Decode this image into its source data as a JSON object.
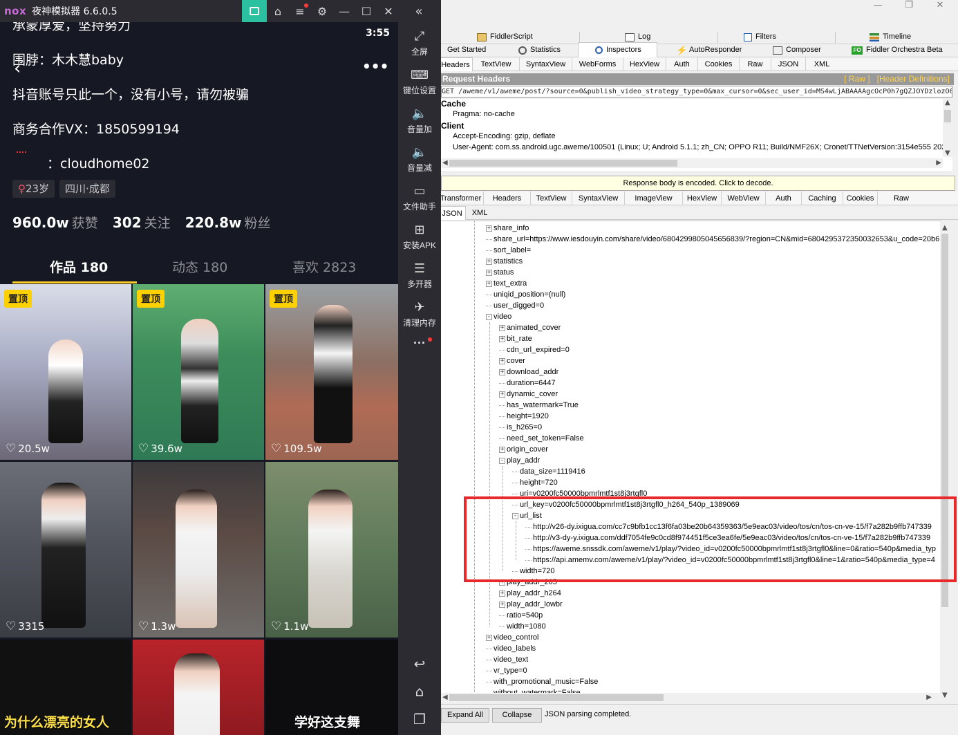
{
  "nox": {
    "logo": "nox",
    "title": "夜神模拟器 6.6.0.5",
    "sidebar": [
      {
        "icon": "fullscreen-icon",
        "label": "全屏"
      },
      {
        "icon": "keyboard-icon",
        "label": "键位设置"
      },
      {
        "icon": "volume-up-icon",
        "label": "音量加"
      },
      {
        "icon": "volume-down-icon",
        "label": "音量减"
      },
      {
        "icon": "file-helper-icon",
        "label": "文件助手"
      },
      {
        "icon": "apk-install-icon",
        "label": "安装APK"
      },
      {
        "icon": "multi-instance-icon",
        "label": "多开器"
      },
      {
        "icon": "clean-memory-icon",
        "label": "清理内存"
      }
    ]
  },
  "phone": {
    "clock": "3:55",
    "bio_lines": [
      "承蒙厚爱，坚持努力",
      "围脖：木木慧baby",
      "抖音账号只此一个，没有小号，请勿被骗",
      "商务合作VX：1850599194",
      "：cloudhome02"
    ],
    "tags": [
      "23岁",
      "四川·成都"
    ],
    "stats": [
      {
        "value": "960.0w",
        "label": "获赞"
      },
      {
        "value": "302",
        "label": "关注"
      },
      {
        "value": "220.8w",
        "label": "粉丝"
      }
    ],
    "tabs": [
      "作品 180",
      "动态 180",
      "喜欢 2823"
    ],
    "pin_label": "置顶",
    "videos": [
      {
        "likes": "20.5w",
        "pinned": true
      },
      {
        "likes": "39.6w",
        "pinned": true
      },
      {
        "likes": "109.5w",
        "pinned": true
      },
      {
        "likes": "3315",
        "pinned": false
      },
      {
        "likes": "1.3w",
        "pinned": false
      },
      {
        "likes": "1.1w",
        "pinned": false
      }
    ],
    "captions": [
      "为什么漂亮的女人",
      "学好这支舞"
    ]
  },
  "fiddler": {
    "top_tabs_row1": [
      "FiddlerScript",
      "Log",
      "Filters",
      "Timeline"
    ],
    "top_tabs_row2": [
      "Get Started",
      "Statistics",
      "Inspectors",
      "AutoResponder",
      "Composer",
      "Fiddler Orchestra Beta"
    ],
    "request_tabs": [
      "Headers",
      "TextView",
      "SyntaxView",
      "WebForms",
      "HexView",
      "Auth",
      "Cookies",
      "Raw",
      "JSON",
      "XML"
    ],
    "request_headers_title": "Request Headers",
    "raw_link": "[ Raw ]",
    "header_defs_link": "[Header Definitions]",
    "request_line": "GET /aweme/v1/aweme/post/?source=0&publish_video_strategy_type=0&max_cursor=0&sec_user_id=MS4wLjABAAAAgcOcP0h7gQZJOYDzlozO6",
    "header_sections": [
      {
        "name": "Cache",
        "lines": [
          "Pragma: no-cache"
        ]
      },
      {
        "name": "Client",
        "lines": [
          "Accept-Encoding: gzip, deflate",
          "User-Agent: com.ss.android.ugc.aweme/100501 (Linux; U; Android 5.1.1; zh_CN; OPPO R11; Build/NMF26X; Cronet/TTNetVersion:3154e555 2020"
        ]
      }
    ],
    "encoded_notice": "Response body is encoded. Click to decode.",
    "response_tabs": [
      "Transformer",
      "Headers",
      "TextView",
      "SyntaxView",
      "ImageView",
      "HexView",
      "WebView",
      "Auth",
      "Caching",
      "Cookies",
      "Raw"
    ],
    "response_subtabs": [
      "JSON",
      "XML"
    ],
    "tree": [
      {
        "d": 0,
        "exp": "+",
        "text": "share_info"
      },
      {
        "d": 0,
        "exp": "",
        "text": "share_url=https://www.iesdouyin.com/share/video/6804299805045656839/?region=CN&mid=6804295372350032653&u_code=20b6"
      },
      {
        "d": 0,
        "exp": "",
        "text": "sort_label="
      },
      {
        "d": 0,
        "exp": "+",
        "text": "statistics"
      },
      {
        "d": 0,
        "exp": "+",
        "text": "status"
      },
      {
        "d": 0,
        "exp": "+",
        "text": "text_extra"
      },
      {
        "d": 0,
        "exp": "",
        "text": "uniqid_position=(null)"
      },
      {
        "d": 0,
        "exp": "",
        "text": "user_digged=0"
      },
      {
        "d": 0,
        "exp": "-",
        "text": "video"
      },
      {
        "d": 1,
        "exp": "+",
        "text": "animated_cover"
      },
      {
        "d": 1,
        "exp": "+",
        "text": "bit_rate"
      },
      {
        "d": 1,
        "exp": "",
        "text": "cdn_url_expired=0"
      },
      {
        "d": 1,
        "exp": "+",
        "text": "cover"
      },
      {
        "d": 1,
        "exp": "+",
        "text": "download_addr"
      },
      {
        "d": 1,
        "exp": "",
        "text": "duration=6447"
      },
      {
        "d": 1,
        "exp": "+",
        "text": "dynamic_cover"
      },
      {
        "d": 1,
        "exp": "",
        "text": "has_watermark=True"
      },
      {
        "d": 1,
        "exp": "",
        "text": "height=1920"
      },
      {
        "d": 1,
        "exp": "",
        "text": "is_h265=0"
      },
      {
        "d": 1,
        "exp": "",
        "text": "need_set_token=False"
      },
      {
        "d": 1,
        "exp": "+",
        "text": "origin_cover"
      },
      {
        "d": 1,
        "exp": "-",
        "text": "play_addr"
      },
      {
        "d": 2,
        "exp": "",
        "text": "data_size=1119416"
      },
      {
        "d": 2,
        "exp": "",
        "text": "height=720"
      },
      {
        "d": 2,
        "exp": "",
        "text": "uri=v0200fc50000bpmrlmtf1st8j3rtgfl0"
      },
      {
        "d": 2,
        "exp": "",
        "text": "url_key=v0200fc50000bpmrlmtf1st8j3rtgfl0_h264_540p_1389069"
      },
      {
        "d": 2,
        "exp": "-",
        "text": "url_list"
      },
      {
        "d": 3,
        "exp": "",
        "text": "http://v26-dy.ixigua.com/cc7c9bfb1cc13f6fa03be20b64359363/5e9eac03/video/tos/cn/tos-cn-ve-15/f7a282b9ffb747339"
      },
      {
        "d": 3,
        "exp": "",
        "text": "http://v3-dy-y.ixigua.com/ddf7054fe9c0cd8f974451f5ce3ea6fe/5e9eac03/video/tos/cn/tos-cn-ve-15/f7a282b9ffb747339"
      },
      {
        "d": 3,
        "exp": "",
        "text": "https://aweme.snssdk.com/aweme/v1/play/?video_id=v0200fc50000bpmrlmtf1st8j3rtgfl0&line=0&ratio=540p&media_typ"
      },
      {
        "d": 3,
        "exp": "",
        "text": "https://api.amemv.com/aweme/v1/play/?video_id=v0200fc50000bpmrlmtf1st8j3rtgfl0&line=1&ratio=540p&media_type=4"
      },
      {
        "d": 2,
        "exp": "",
        "text": "width=720"
      },
      {
        "d": 1,
        "exp": "+",
        "text": "play_addr_265"
      },
      {
        "d": 1,
        "exp": "+",
        "text": "play_addr_h264"
      },
      {
        "d": 1,
        "exp": "+",
        "text": "play_addr_lowbr"
      },
      {
        "d": 1,
        "exp": "",
        "text": "ratio=540p"
      },
      {
        "d": 1,
        "exp": "",
        "text": "width=1080"
      },
      {
        "d": 0,
        "exp": "+",
        "text": "video_control"
      },
      {
        "d": 0,
        "exp": "",
        "text": "video_labels"
      },
      {
        "d": 0,
        "exp": "",
        "text": "video_text"
      },
      {
        "d": 0,
        "exp": "",
        "text": "vr_type=0"
      },
      {
        "d": 0,
        "exp": "",
        "text": "with_promotional_music=False"
      },
      {
        "d": 0,
        "exp": "",
        "text": "without_watermark=False"
      }
    ],
    "expand_all": "Expand All",
    "collapse": "Collapse",
    "status": "JSON parsing completed."
  }
}
